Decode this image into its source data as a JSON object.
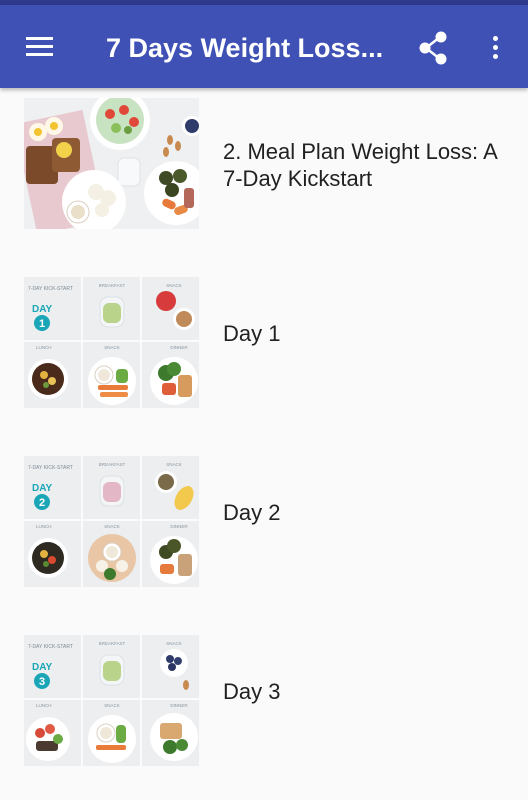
{
  "appbar": {
    "title": "7 Days Weight Loss...",
    "menu_icon": "hamburger-menu-icon",
    "share_icon": "share-icon",
    "more_icon": "more-vert-icon",
    "color": "#3f51b5"
  },
  "items": [
    {
      "label": "2. Meal Plan Weight Loss: A 7-Day Kickstart",
      "thumbnail": "meal-plan-photo"
    },
    {
      "label": "Day 1",
      "thumbnail": "day-1-meal-photo",
      "badge": "1"
    },
    {
      "label": "Day 2",
      "thumbnail": "day-2-meal-photo",
      "badge": "2"
    },
    {
      "label": "Day 3",
      "thumbnail": "day-3-meal-photo",
      "badge": "3"
    }
  ],
  "thumb_text": {
    "kickstart": "7-DAY KICK-START",
    "day_word": "DAY",
    "breakfast": "BREAKFAST",
    "snack": "SNACK",
    "lunch": "LUNCH",
    "dinner": "DINNER"
  }
}
